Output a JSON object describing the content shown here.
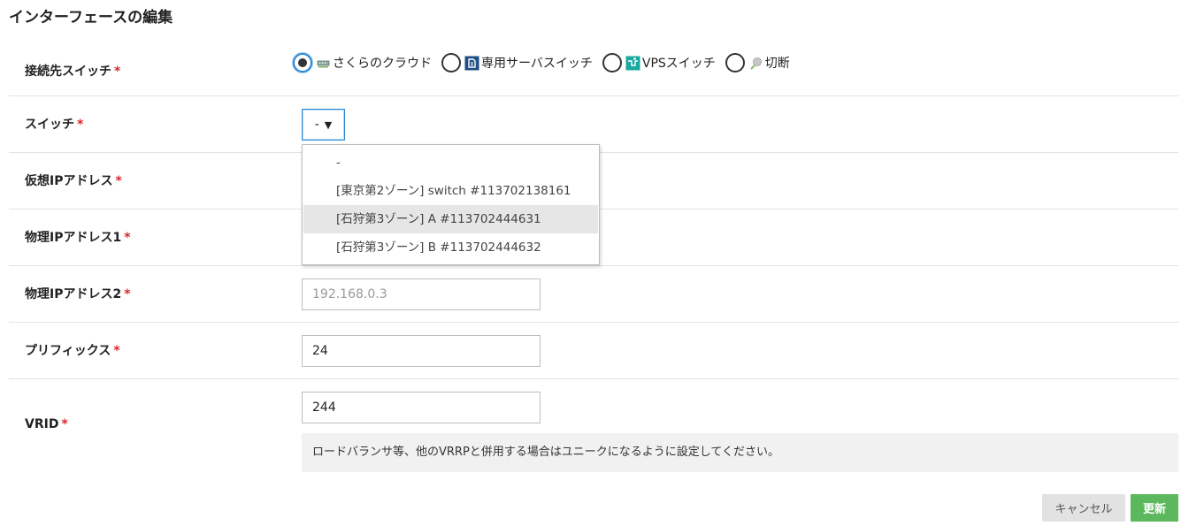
{
  "page_title": "インターフェースの編集",
  "required_mark": "*",
  "fields": {
    "connection_switch": {
      "label": "接続先スイッチ",
      "options": [
        {
          "label": "さくらのクラウド",
          "icon": "cloud-switch-icon",
          "selected": true
        },
        {
          "label": "専用サーバスイッチ",
          "icon": "dedicated-server-icon",
          "selected": false
        },
        {
          "label": "VPSスイッチ",
          "icon": "vps-switch-icon",
          "selected": false
        },
        {
          "label": "切断",
          "icon": "disconnect-icon",
          "selected": false
        }
      ]
    },
    "switch": {
      "label": "スイッチ",
      "selected_value": "-",
      "dropdown_options": [
        {
          "label": "-",
          "highlighted": false
        },
        {
          "label": "[東京第2ゾーン] switch #113702138161",
          "highlighted": false
        },
        {
          "label": "[石狩第3ゾーン] A #113702444631",
          "highlighted": true
        },
        {
          "label": "[石狩第3ゾーン] B #113702444632",
          "highlighted": false
        }
      ]
    },
    "virtual_ip": {
      "label": "仮想IPアドレス",
      "value": "",
      "placeholder": ""
    },
    "physical_ip1": {
      "label": "物理IPアドレス1",
      "value": "",
      "placeholder": ""
    },
    "physical_ip2": {
      "label": "物理IPアドレス2",
      "value": "",
      "placeholder": "192.168.0.3"
    },
    "prefix": {
      "label": "プリフィックス",
      "value": "24"
    },
    "vrid": {
      "label": "VRID",
      "value": "244",
      "note": "ロードバランサ等、他のVRRPと併用する場合はユニークになるように設定してください。"
    }
  },
  "buttons": {
    "cancel": "キャンセル",
    "update": "更新"
  },
  "colors": {
    "required": "#d9262c",
    "focus": "#2b8ad6",
    "primary_button": "#5cb85c",
    "secondary_button": "#e2e2e2",
    "note_background": "#f1f1f1"
  }
}
